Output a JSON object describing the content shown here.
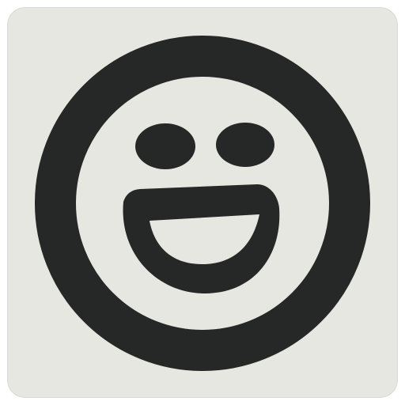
{
  "icon": {
    "name": "smiley-face-icon",
    "colors": {
      "tile_background": "#e7e7e2",
      "tile_border": "#d9d9d3",
      "glyph": "#262827"
    }
  }
}
